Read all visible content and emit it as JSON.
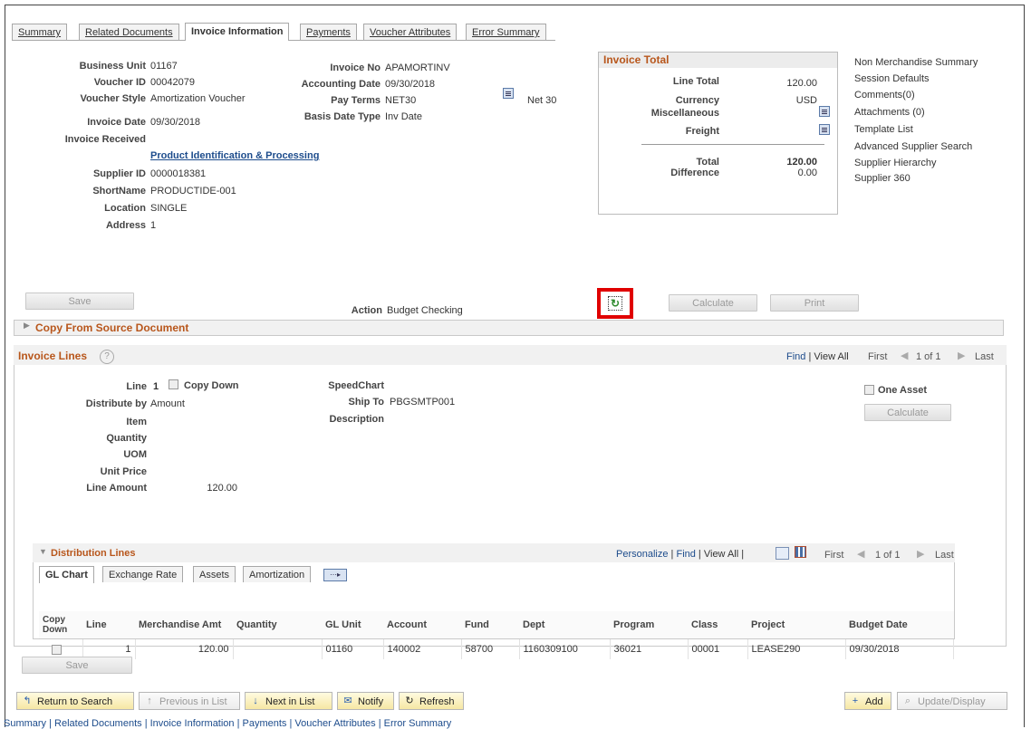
{
  "tabs": [
    "Summary",
    "Related Documents",
    "Invoice Information",
    "Payments",
    "Voucher Attributes",
    "Error Summary"
  ],
  "header_left": [
    {
      "label": "Business Unit",
      "value": "01167"
    },
    {
      "label": "Voucher ID",
      "value": "00042079"
    },
    {
      "label": "Voucher Style",
      "value": "Amortization Voucher"
    },
    {
      "label": "Invoice Date",
      "value": "09/30/2018"
    },
    {
      "label": "Invoice Received",
      "value": ""
    }
  ],
  "product_link": "Product Identification & Processing",
  "supplier": [
    {
      "label": "Supplier ID",
      "value": "0000018381"
    },
    {
      "label": "ShortName",
      "value": "PRODUCTIDE-001"
    },
    {
      "label": "Location",
      "value": "SINGLE"
    },
    {
      "label": "Address",
      "value": "1"
    }
  ],
  "header_mid": [
    {
      "label": "Invoice No",
      "value": "APAMORTINV"
    },
    {
      "label": "Accounting Date",
      "value": "09/30/2018"
    },
    {
      "label": "Pay Terms",
      "value": "NET30"
    },
    {
      "label": "Basis Date Type",
      "value": "Inv Date"
    }
  ],
  "pay_terms_desc": "Net 30",
  "invoice_total": {
    "title": "Invoice Total",
    "line_total_label": "Line Total",
    "line_total": "120.00",
    "currency_label": "Currency",
    "currency": "USD",
    "misc_label": "Miscellaneous",
    "freight_label": "Freight",
    "total_label": "Total",
    "total": "120.00",
    "difference_label": "Difference",
    "difference": "0.00"
  },
  "right_links": [
    "Non Merchandise Summary",
    "Session Defaults",
    "Comments(0)",
    "Attachments (0)",
    "Template List",
    "Advanced Supplier Search",
    "Supplier Hierarchy",
    "Supplier 360"
  ],
  "action_row": {
    "save": "Save",
    "action_label": "Action",
    "action_value": "Budget Checking",
    "calculate": "Calculate",
    "print": "Print"
  },
  "copy_from": "Copy From Source Document",
  "invoice_lines": {
    "title": "Invoice Lines",
    "help": "?",
    "find": "Find",
    "view_all": "View All",
    "first": "First",
    "count": "1 of 1",
    "last": "Last",
    "line_label": "Line",
    "line_value": "1",
    "copy_down": "Copy Down",
    "distribute_label": "Distribute by",
    "distribute_value": "Amount",
    "item_label": "Item",
    "quantity_label": "Quantity",
    "uom_label": "UOM",
    "unit_price_label": "Unit Price",
    "line_amount_label": "Line Amount",
    "line_amount": "120.00",
    "speedchart_label": "SpeedChart",
    "shipto_label": "Ship To",
    "shipto_value": "PBGSMTP001",
    "description_label": "Description",
    "one_asset": "One Asset",
    "calculate": "Calculate"
  },
  "distribution": {
    "title": "Distribution Lines",
    "personalize": "Personalize",
    "find": "Find",
    "view_all": "View All",
    "first": "First",
    "count": "1 of 1",
    "last": "Last",
    "tabs": [
      "GL Chart",
      "Exchange Rate",
      "Assets",
      "Amortization"
    ],
    "columns": [
      "Copy Down",
      "Line",
      "Merchandise Amt",
      "Quantity",
      "GL Unit",
      "Account",
      "Fund",
      "Dept",
      "Program",
      "Class",
      "Project",
      "Budget Date"
    ],
    "rows": [
      [
        "",
        "1",
        "120.00",
        "",
        "01160",
        "140002",
        "58700",
        "1160309100",
        "36021",
        "00001",
        "LEASE290",
        "09/30/2018"
      ]
    ]
  },
  "bottom_save": "Save",
  "toolbar": {
    "return": "Return to Search",
    "previous": "Previous in List",
    "next": "Next in List",
    "notify": "Notify",
    "refresh": "Refresh",
    "add": "Add",
    "update": "Update/Display"
  },
  "footer_links": "Summary | Related Documents | Invoice Information | Payments | Voucher Attributes | Error Summary"
}
